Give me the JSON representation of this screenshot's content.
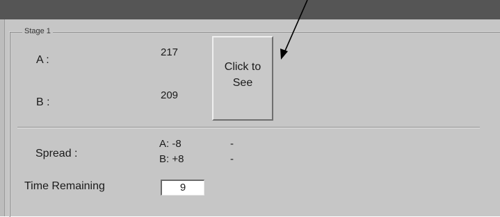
{
  "panel": {
    "title": "Stage 1"
  },
  "values": {
    "a_label": "A :",
    "a_value": "217",
    "b_label": "B :",
    "b_value": "209"
  },
  "reveal_button": {
    "label": "Click to\nSee"
  },
  "spread": {
    "label": "Spread :",
    "a": "A: -8",
    "b": "B: +8",
    "a_dash": "-",
    "b_dash": "-"
  },
  "time": {
    "label": "Time Remaining",
    "value": "9"
  },
  "colors": {
    "window_bg": "#c6c6c6",
    "titlebar": "#555555"
  }
}
